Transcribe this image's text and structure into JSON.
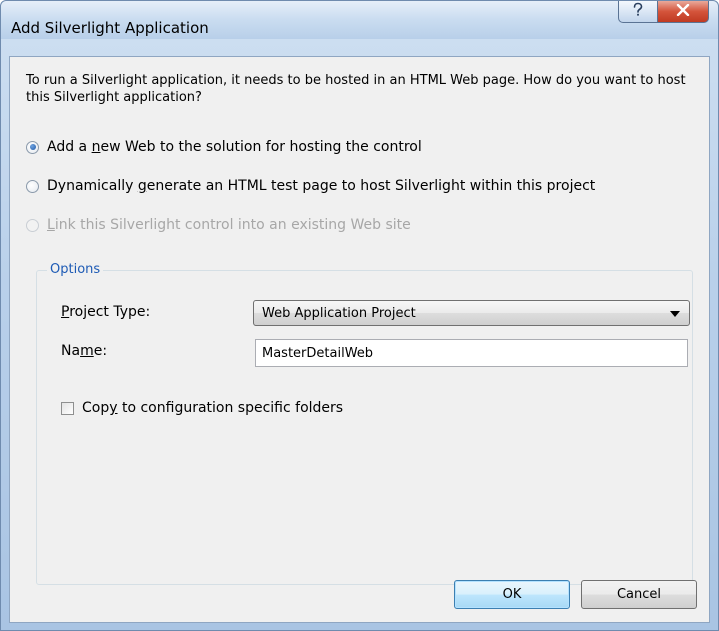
{
  "window": {
    "title": "Add Silverlight Application",
    "help_icon": "question-mark-icon",
    "close_icon": "close-icon"
  },
  "intro": {
    "text": "To run a Silverlight application, it needs to be hosted in an HTML Web page. How do you want to host this Silverlight application?"
  },
  "hosting_options": [
    {
      "before": "Add a ",
      "key": "n",
      "after": "ew Web to the solution for hosting the control",
      "checked": true,
      "enabled": true
    },
    {
      "before": "Dynamically ",
      "key": "g",
      "after": "enerate an HTML test page to host Silverlight within this project",
      "checked": false,
      "enabled": true
    },
    {
      "before": "",
      "key": "L",
      "after": "ink this Silverlight control into an existing Web site",
      "checked": false,
      "enabled": false
    }
  ],
  "options_group": {
    "legend": "Options",
    "project_type_label": {
      "key": "P",
      "after": "roject Type:"
    },
    "project_type_value": "Web Application Project",
    "name_label": {
      "before": "Na",
      "key": "m",
      "after": "e:"
    },
    "name_value": "MasterDetailWeb",
    "copy_checkbox": {
      "before": "Cop",
      "key": "y",
      "after": " to configuration specific folders",
      "checked": false
    }
  },
  "buttons": {
    "ok": "OK",
    "cancel": "Cancel"
  },
  "colors": {
    "accent_legend": "#1e5bb5",
    "close_button": "#c9452c",
    "dialog_background": "#f0f0f0"
  }
}
